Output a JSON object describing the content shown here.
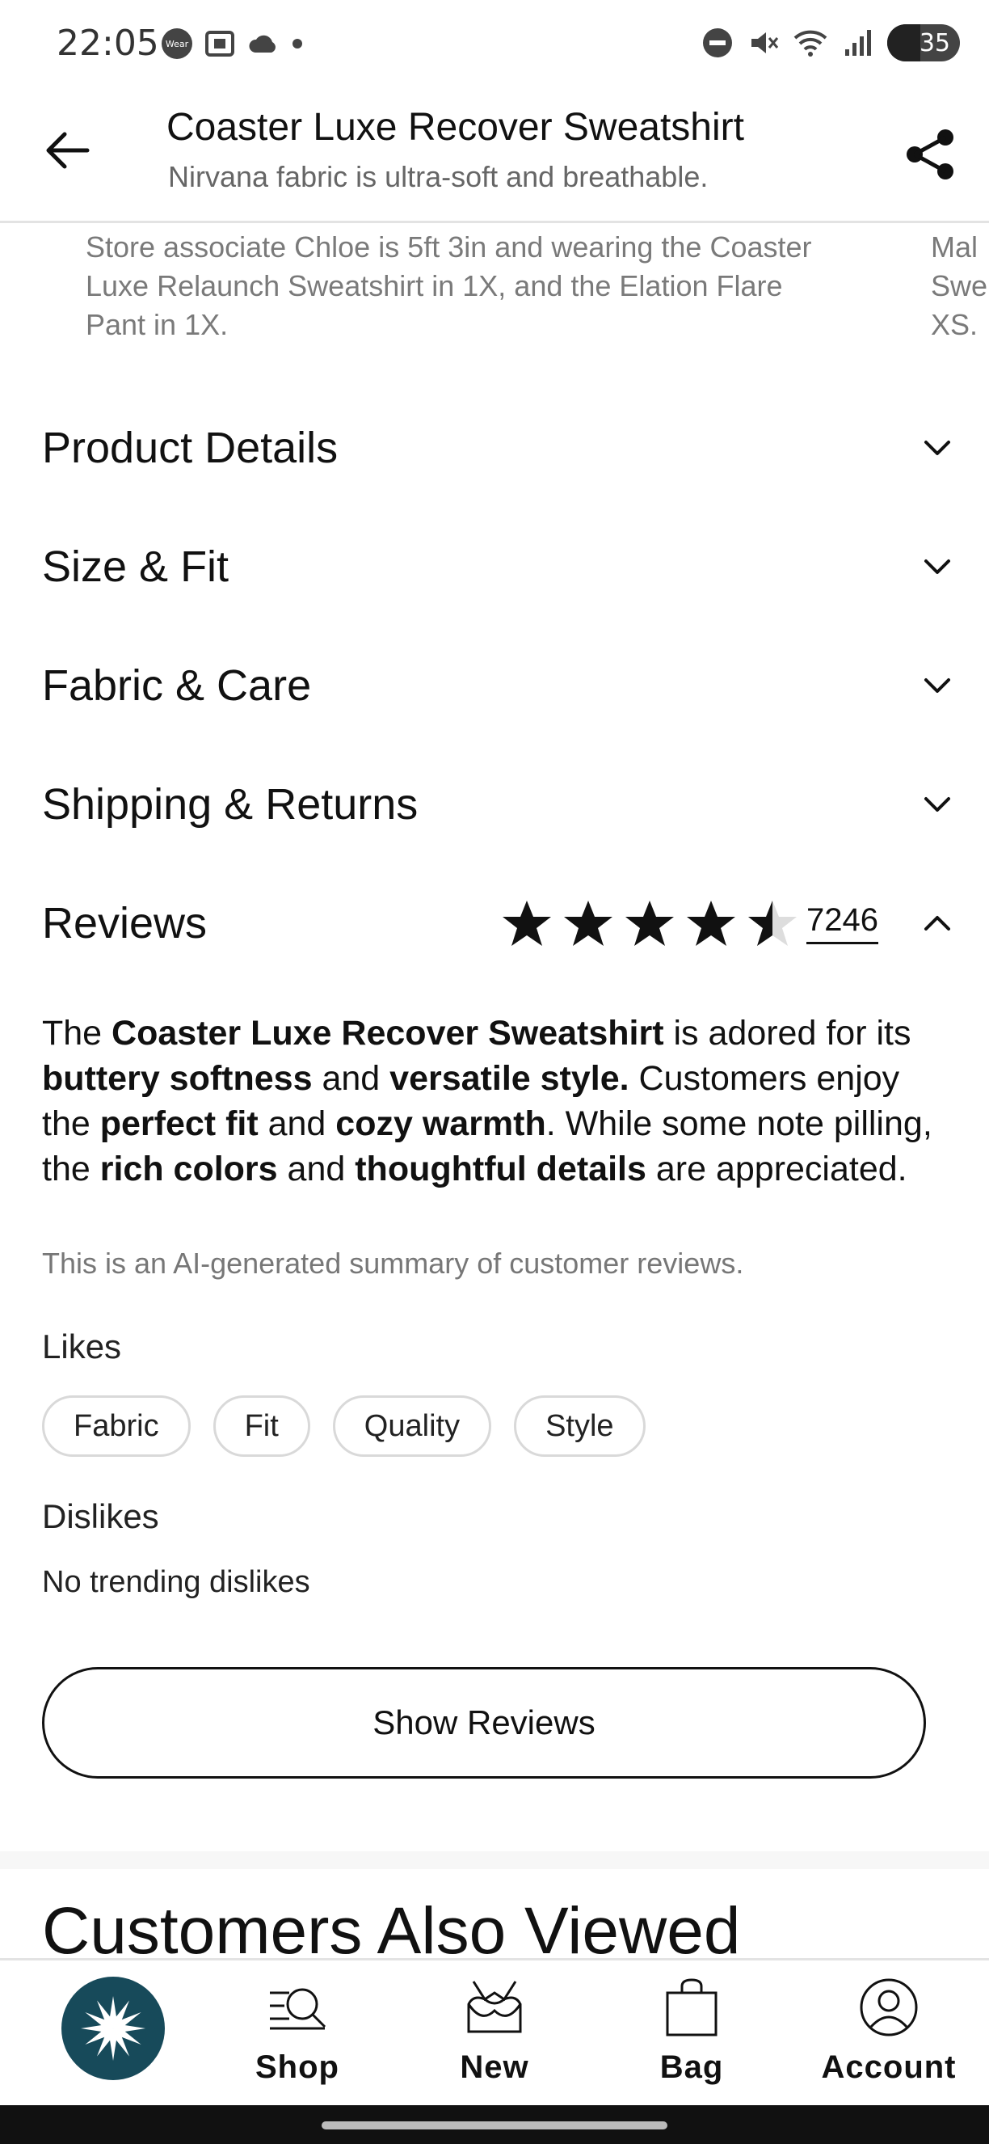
{
  "status_bar": {
    "time": "22:05",
    "wear_label": "Wear",
    "battery": "35",
    "icons_left": [
      "wear-icon",
      "screenshot-icon",
      "cloud-icon",
      "dot-icon"
    ],
    "icons_right": [
      "do-not-disturb-icon",
      "mute-icon",
      "wifi-icon",
      "signal-icon",
      "battery-icon"
    ]
  },
  "header": {
    "title": "Coaster Luxe Recover Sweatshirt",
    "subtitle": "Nirvana fabric is ultra-soft and breathable."
  },
  "caption": {
    "text": "Store associate Chloe is 5ft 3in and wearing the Coaster Luxe Relaunch Sweatshirt in 1X, and the Elation Flare Pant in 1X.",
    "next_text": "Mal\nSwe\nXS."
  },
  "accordion": [
    {
      "label": "Product Details",
      "expanded": false
    },
    {
      "label": "Size & Fit",
      "expanded": false
    },
    {
      "label": "Fabric & Care",
      "expanded": false
    },
    {
      "label": "Shipping & Returns",
      "expanded": false
    }
  ],
  "reviews": {
    "label": "Reviews",
    "rating": 4.5,
    "count": "7246",
    "summary": {
      "p1": "The ",
      "b1": "Coaster Luxe Recover Sweatshirt",
      "p2": " is adored for its ",
      "b2": "buttery softness",
      "p3": " and ",
      "b3": "versatile style.",
      "p4": " Customers enjoy the ",
      "b4": "perfect fit",
      "p5": " and ",
      "b5": "cozy warmth",
      "p6": ". While some note pilling, the ",
      "b6": "rich colors",
      "p7": " and ",
      "b7": "thoughtful details",
      "p8": " are appreciated."
    },
    "ai_note": "This is an AI-generated summary of customer reviews.",
    "likes_label": "Likes",
    "likes": [
      "Fabric",
      "Fit",
      "Quality",
      "Style"
    ],
    "dislikes_label": "Dislikes",
    "dislikes_value": "No trending dislikes",
    "show_button": "Show Reviews"
  },
  "also_viewed": {
    "title": "Customers Also Viewed"
  },
  "bottom_nav": {
    "items": [
      {
        "label": "Shop",
        "icon": "shop-search-icon"
      },
      {
        "label": "New",
        "icon": "new-bra-icon"
      },
      {
        "label": "Bag",
        "icon": "bag-icon"
      },
      {
        "label": "Account",
        "icon": "account-icon"
      }
    ]
  },
  "colors": {
    "brand": "#174a5a",
    "text": "#111111",
    "muted": "#777777",
    "border": "#d9d9d9"
  }
}
